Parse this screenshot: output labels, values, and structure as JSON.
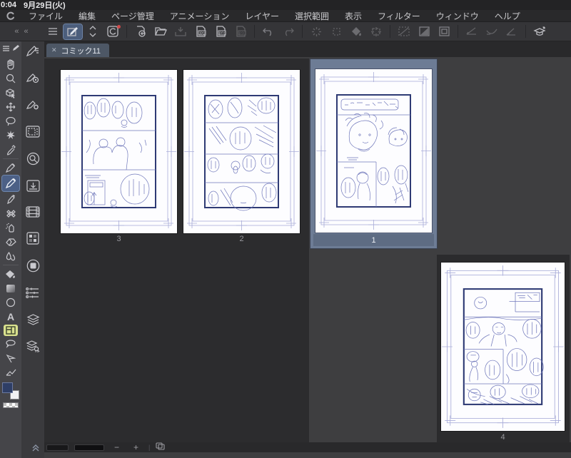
{
  "statusbar": {
    "time": "0:04",
    "date": "9月29日(火)"
  },
  "menubar": {
    "items": [
      "ファイル",
      "編集",
      "ページ管理",
      "アニメーション",
      "レイヤー",
      "選択範囲",
      "表示",
      "フィルター",
      "ウィンドウ",
      "ヘルプ"
    ]
  },
  "toolbar": {
    "collapse_left": "« «",
    "export_jpg_label": "jpg",
    "export_png_label": "png",
    "export_psd_label": "psd"
  },
  "tabbar": {
    "close_icon": "✕",
    "active_tab_label": "コミック11"
  },
  "sidebar": {
    "text_tool_label": "A"
  },
  "page_manager": {
    "pages": [
      {
        "number": "3",
        "selected": false
      },
      {
        "number": "2",
        "selected": false
      },
      {
        "number": "1",
        "selected": true
      },
      {
        "number": "4",
        "selected": false
      }
    ]
  },
  "bottombar": {
    "zoom_out": "−",
    "zoom_in": "+",
    "separator": "|"
  },
  "colors": {
    "selected_cell": "#6d7c95",
    "tool_highlight": "#4c6086",
    "panel_tool_highlight": "#d9e18e",
    "sketch_line": "#7078bb",
    "panel_frame": "#2e3a74",
    "guide_line": "#a9add9",
    "canvas_bg": "#3e3e40",
    "dark_region_bg": "#2c2c2e"
  }
}
